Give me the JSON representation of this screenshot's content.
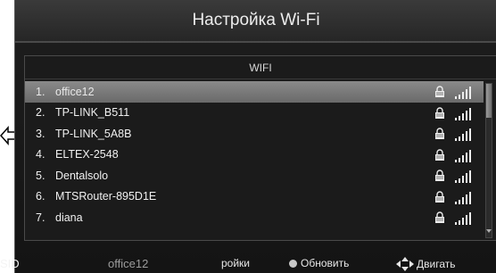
{
  "window": {
    "title": "Настройка Wi-Fi"
  },
  "panel": {
    "header": "WIFI"
  },
  "networks": [
    {
      "num": "1.",
      "name": "office12",
      "icon_lock": "lock-icon",
      "icon_signal": "signal-strength-icon",
      "selected": true
    },
    {
      "num": "2.",
      "name": "TP-LINK_B511",
      "icon_lock": "lock-icon",
      "icon_signal": "signal-strength-icon"
    },
    {
      "num": "3.",
      "name": "TP-LINK_5A8B",
      "icon_lock": "lock-icon",
      "icon_signal": "signal-strength-icon"
    },
    {
      "num": "4.",
      "name": "ELTEX-2548",
      "icon_lock": "lock-icon",
      "icon_signal": "signal-strength-icon"
    },
    {
      "num": "5.",
      "name": "Dentalsolo",
      "icon_lock": "lock-icon",
      "icon_signal": "signal-strength-icon"
    },
    {
      "num": "6.",
      "name": "MTSRouter-895D1E",
      "icon_lock": "lock-icon",
      "icon_signal": "signal-strength-icon"
    },
    {
      "num": "7.",
      "name": "diana",
      "icon_lock": "lock-icon",
      "icon_signal": "signal-strength-icon"
    }
  ],
  "footer": {
    "ssid_label": "SID",
    "ssid_value": "office12",
    "settings_label": "ройки",
    "refresh_label": "Обновить",
    "move_label": "Двигать"
  },
  "colors": {
    "background": "#1b1b1b",
    "selected_row": "#7a7a7a",
    "text": "#f0f0f0"
  }
}
